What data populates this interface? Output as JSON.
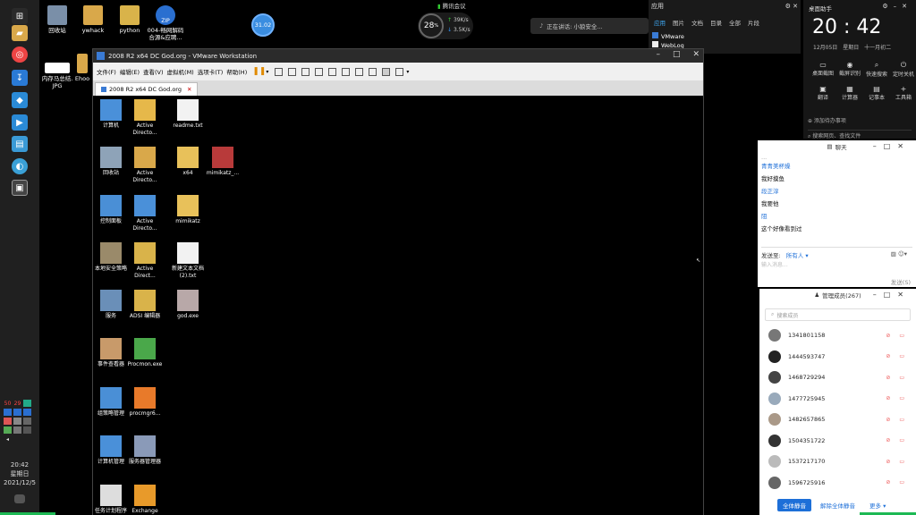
{
  "taskbar": {
    "icons": [
      "windows-icon",
      "folder-icon",
      "chrome-icon",
      "pin-icon",
      "shield-icon",
      "meeting-icon",
      "files-icon",
      "remote-icon",
      "vmware-icon"
    ],
    "tray": [
      "50",
      "29",
      "",
      "",
      "",
      "",
      "",
      "",
      "",
      ""
    ],
    "clock_time": "20:42",
    "clock_day": "星期日",
    "clock_date": "2021/12/5"
  },
  "desktop_icons": [
    {
      "label": "回收站",
      "color": "#7a8fa8"
    },
    {
      "label": "ywhack",
      "color": "#d9a84a"
    },
    {
      "label": "python",
      "color": "#d9b34a"
    },
    {
      "label": "004-畅网解码 合源&应聘...",
      "color": "#2a6fd0",
      "badge": "ZIP"
    },
    {
      "label": "内存马总结. JPG",
      "color": "#ffffff"
    },
    {
      "label": "Ehoo",
      "color": "#d9a84a"
    }
  ],
  "vm_bubble": "31.02",
  "net": {
    "value": "28",
    "unit": "%",
    "up": "39K/s",
    "down": "3.5K/s"
  },
  "meeting_tag": "腾讯会议",
  "speaking": "正在讲话: 小狼安全...",
  "app_panel": {
    "title": "应用",
    "tabs": [
      "应用",
      "图片",
      "文档",
      "目录",
      "全部",
      "片段"
    ],
    "rows": [
      "VMware",
      "WebLog"
    ]
  },
  "vmware": {
    "title": "2008 R2 x64 DC God.org - VMware Workstation",
    "menu": [
      "文件(F)",
      "编辑(E)",
      "查看(V)",
      "虚拟机(M)",
      "选项卡(T)",
      "帮助(H)"
    ],
    "tab": "2008 R2 x64 DC God.org",
    "guest_icons": [
      {
        "label": "计算机",
        "color": "#4a90d9"
      },
      {
        "label": "Active Directo...",
        "color": "#e6b84a"
      },
      {
        "label": "readme.txt",
        "color": "#f2f2f2"
      },
      {
        "label": "回收站",
        "color": "#8ea3b8"
      },
      {
        "label": "Active Directo...",
        "color": "#d9a84a"
      },
      {
        "label": "x64",
        "color": "#e8c15a"
      },
      {
        "label": "mimikatz_...",
        "color": "#b83a3a"
      },
      {
        "label": "控制面板",
        "color": "#4a8fd6"
      },
      {
        "label": "Active Directo...",
        "color": "#4a90d9"
      },
      {
        "label": "mimikatz",
        "color": "#e8c15a"
      },
      {
        "label": "本地安全策略",
        "color": "#9a8a6a"
      },
      {
        "label": "Active Direct...",
        "color": "#d9b34a"
      },
      {
        "label": "新建文本文档 (2).txt",
        "color": "#f2f2f2"
      },
      {
        "label": "服务",
        "color": "#6a8fb8"
      },
      {
        "label": "ADSI 编辑器",
        "color": "#d9b34a"
      },
      {
        "label": "god.exe",
        "color": "#b8a8a8"
      },
      {
        "label": "事件查看器",
        "color": "#c89a6a"
      },
      {
        "label": "Procmon.exe",
        "color": "#4aa84a"
      },
      {
        "label": "组策略管理",
        "color": "#4a8fd6"
      },
      {
        "label": "procmgr6...",
        "color": "#e87a2a"
      },
      {
        "label": "计算机管理",
        "color": "#4a90d9"
      },
      {
        "label": "服务器管理器",
        "color": "#8a9ab8"
      },
      {
        "label": "任务计划程序",
        "color": "#dddddd"
      },
      {
        "label": "Exchange",
        "color": "#e89a2a"
      }
    ]
  },
  "clock_panel": {
    "title": "桌面助手",
    "time": "20 : 42",
    "date": "12月05日",
    "weekday": "星期日",
    "lunar": "十一月初二",
    "tools": [
      {
        "icon": "screenshot-icon",
        "glyph": "▭",
        "label": "桌面截图"
      },
      {
        "icon": "eye-icon",
        "glyph": "◉",
        "label": "截屏识别"
      },
      {
        "icon": "search-icon",
        "glyph": "⌕",
        "label": "快速搜索"
      },
      {
        "icon": "power-icon",
        "glyph": "⏻",
        "label": "定时关机"
      },
      {
        "icon": "translate-icon",
        "glyph": "▣",
        "label": "翻译"
      },
      {
        "icon": "calc-icon",
        "glyph": "▦",
        "label": "计算器"
      },
      {
        "icon": "note-icon",
        "glyph": "▤",
        "label": "记事本"
      },
      {
        "icon": "add-icon",
        "glyph": "+",
        "label": "工具箱"
      }
    ],
    "note": "⊕ 添加待办事项",
    "search": "⌕ 搜索网页、查找文件"
  },
  "chat": {
    "title": "聊天",
    "messages": [
      {
        "text": "青青美杯燥",
        "blue": true
      },
      {
        "text": "我好摸鱼",
        "blue": false
      },
      {
        "text": "段正淳",
        "blue": true
      },
      {
        "text": "我要他",
        "blue": false
      },
      {
        "text": "阻",
        "blue": true
      },
      {
        "text": "这个好像看到过",
        "blue": false
      }
    ],
    "send_to_label": "发送至:",
    "send_to_value": "所有人 ▾",
    "placeholder": "输入消息...",
    "send_button": "发送(S)"
  },
  "members": {
    "title": "管理成员(267)",
    "search_placeholder": "搜索成员",
    "list": [
      {
        "name": "1341801158",
        "color": "#777"
      },
      {
        "name": "1444593747",
        "color": "#222"
      },
      {
        "name": "1468729294",
        "color": "#444"
      },
      {
        "name": "1477725945",
        "color": "#9ab"
      },
      {
        "name": "1482657865",
        "color": "#a98"
      },
      {
        "name": "1504351722",
        "color": "#333"
      },
      {
        "name": "1537217170",
        "color": "#bbb"
      },
      {
        "name": "1596725916",
        "color": "#666"
      }
    ],
    "mute_all": "全体静音",
    "unmute_all": "解除全体静音",
    "more": "更多 ▾"
  }
}
